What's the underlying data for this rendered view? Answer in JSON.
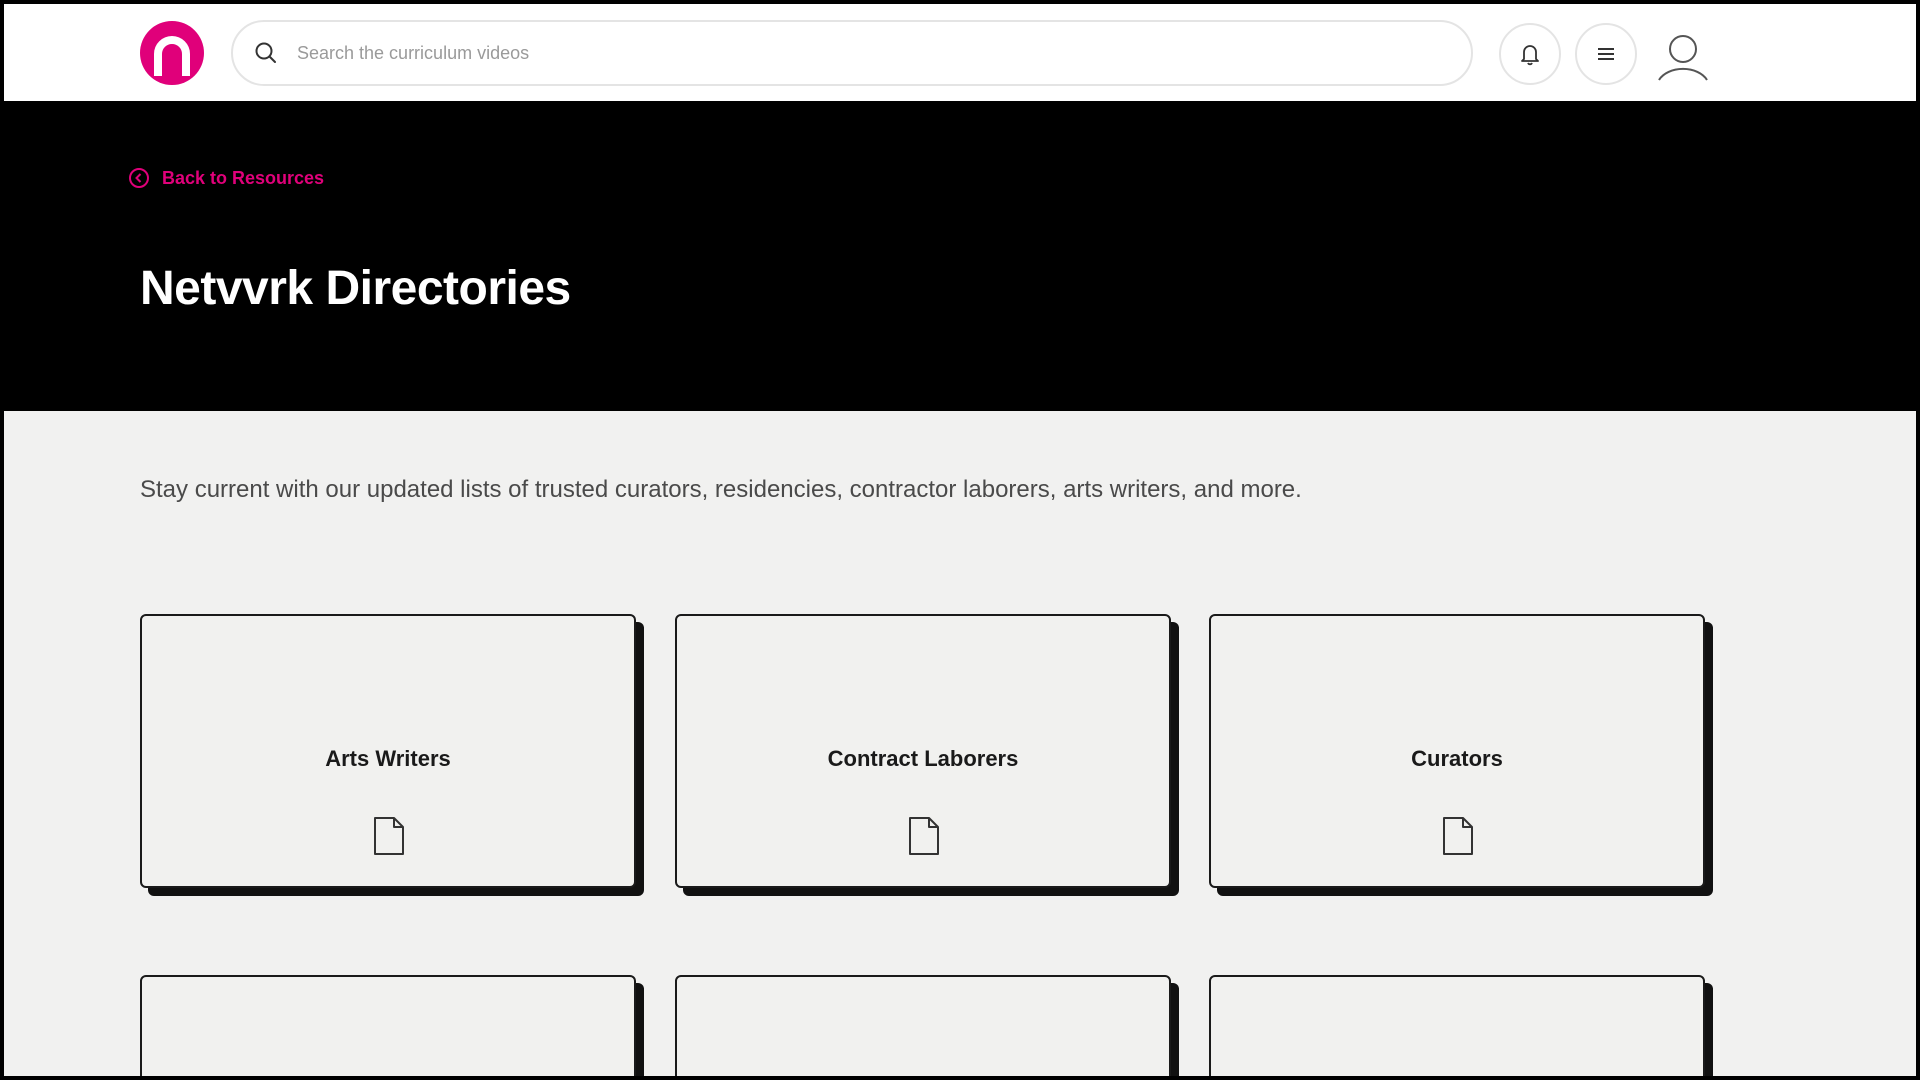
{
  "header": {
    "search_placeholder": "Search the curriculum videos",
    "icons": {
      "logo": "netvvrk-n-logo",
      "search": "search-icon",
      "notifications": "bell-icon",
      "menu": "hamburger-menu-icon",
      "profile": "user-icon"
    }
  },
  "hero": {
    "back_label": "Back to Resources",
    "title": "Netvvrk Directories"
  },
  "main": {
    "description": "Stay current with our updated lists of trusted curators, residencies, contractor laborers, arts writers, and more.",
    "cards": [
      {
        "title": "Arts Writers",
        "icon": "document-icon"
      },
      {
        "title": "Contract Laborers",
        "icon": "document-icon"
      },
      {
        "title": "Curators",
        "icon": "document-icon"
      }
    ]
  },
  "colors": {
    "accent": "#e0007a",
    "hero_background": "#000000",
    "page_background": "#f1f1f0",
    "card_shadow": "#111111"
  }
}
